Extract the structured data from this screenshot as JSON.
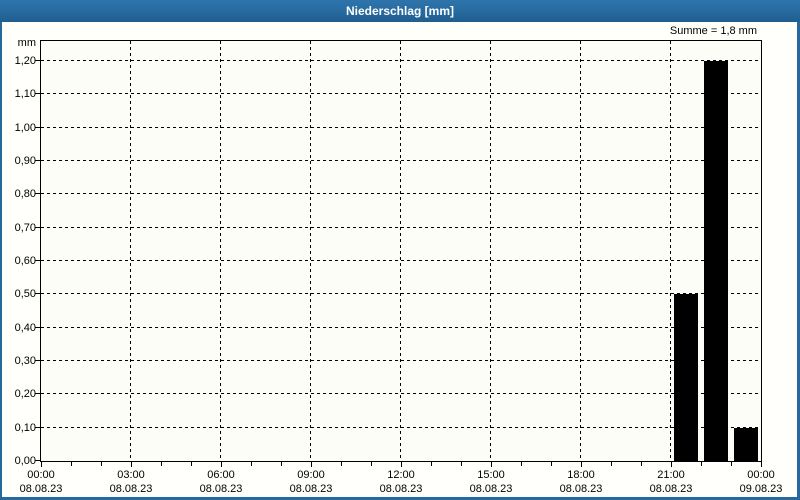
{
  "window": {
    "title": "Niederschlag [mm]"
  },
  "colors": {
    "titlebar_blue": "#26699e",
    "frame_blue": "#26699e",
    "bar_black": "#000000",
    "title_text": "#ffffff",
    "axis_text": "#000000",
    "plot_background": "#fdfdf7"
  },
  "chart_data": {
    "type": "bar",
    "title": "Niederschlag [mm]",
    "y_axis_unit": "mm",
    "sum_annotation": "Summe = 1,8 mm",
    "ylabel": "mm",
    "xlabel": "",
    "ylim": [
      0,
      1.26
    ],
    "y_axis_max": 1.2,
    "grid": "dashed",
    "legend": "none",
    "yticks": [
      {
        "value": 0.0,
        "label": "0,00"
      },
      {
        "value": 0.1,
        "label": "0,10"
      },
      {
        "value": 0.2,
        "label": "0,20"
      },
      {
        "value": 0.3,
        "label": "0,30"
      },
      {
        "value": 0.4,
        "label": "0,40"
      },
      {
        "value": 0.5,
        "label": "0,50"
      },
      {
        "value": 0.6,
        "label": "0,60"
      },
      {
        "value": 0.7,
        "label": "0,70"
      },
      {
        "value": 0.8,
        "label": "0,80"
      },
      {
        "value": 0.9,
        "label": "0,90"
      },
      {
        "value": 1.0,
        "label": "1,00"
      },
      {
        "value": 1.1,
        "label": "1,10"
      },
      {
        "value": 1.2,
        "label": "1,20"
      }
    ],
    "x_total_hours": 24,
    "x_hours_per_major": 3,
    "x_minor_every_hours": 1,
    "x_major_ticks": [
      {
        "time": "00:00",
        "date": "08.08.23"
      },
      {
        "time": "03:00",
        "date": "08.08.23"
      },
      {
        "time": "06:00",
        "date": "08.08.23"
      },
      {
        "time": "09:00",
        "date": "08.08.23"
      },
      {
        "time": "12:00",
        "date": "08.08.23"
      },
      {
        "time": "15:00",
        "date": "08.08.23"
      },
      {
        "time": "18:00",
        "date": "08.08.23"
      },
      {
        "time": "21:00",
        "date": "08.08.23"
      },
      {
        "time": "00:00",
        "date": "09.08.23"
      }
    ],
    "bars": [
      {
        "hour_index": 21,
        "slot": "21:00-22:00",
        "value": 0.5,
        "value_label": "0,50"
      },
      {
        "hour_index": 22,
        "slot": "22:00-23:00",
        "value": 1.2,
        "value_label": "1,20"
      },
      {
        "hour_index": 23,
        "slot": "23:00-00:00",
        "value": 0.1,
        "value_label": "0,10"
      }
    ],
    "sum_value": 1.8
  }
}
